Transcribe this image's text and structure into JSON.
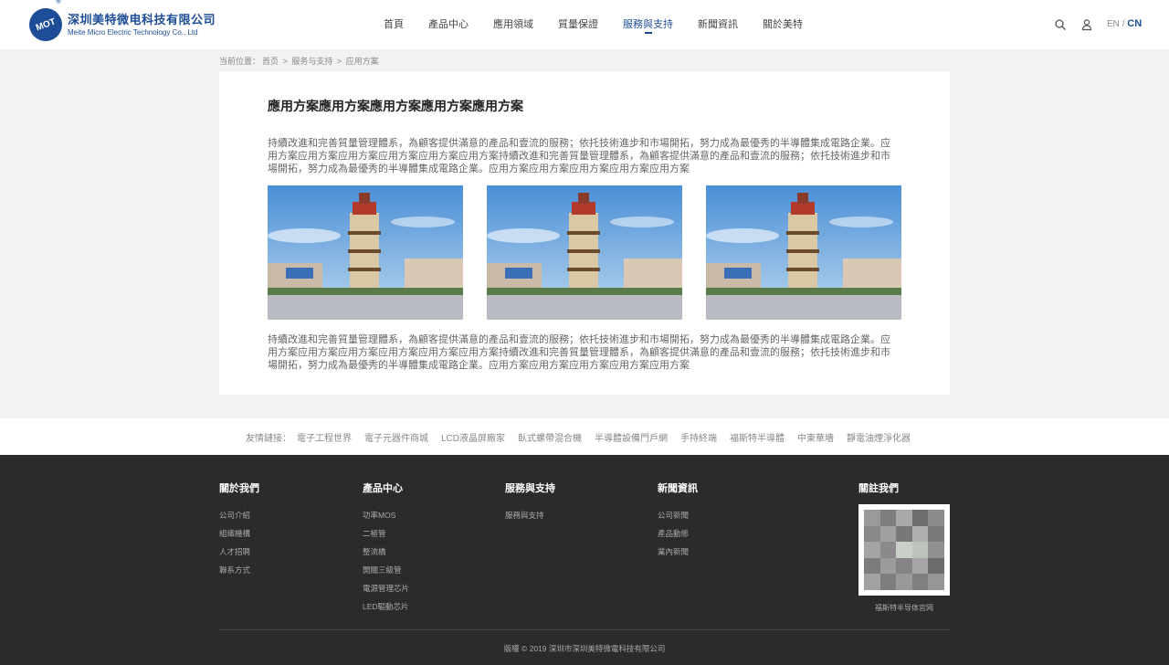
{
  "brand": {
    "mark_text": "MOT",
    "reg_symbol": "®",
    "name_cn": "深圳美特微电科技有限公司",
    "name_en": "Meite Micro Electric Technology Co., Ltd",
    "color": "#1d4d96"
  },
  "nav": {
    "items": [
      "首頁",
      "產品中心",
      "應用領域",
      "質量保證",
      "服務與支持",
      "新聞資訊",
      "關於美特"
    ],
    "active_index": 4
  },
  "header_icons": [
    "search-icon",
    "user-icon"
  ],
  "lang": {
    "en": "EN",
    "sep": "/",
    "cn": "CN"
  },
  "breadcrumb": {
    "prefix": "当前位置：",
    "items": [
      "首页",
      "服务与支持",
      "应用方案"
    ],
    "sep": ">"
  },
  "article": {
    "title": "應用方案應用方案應用方案應用方案應用方案",
    "para1": "持續改進和完善質量管理體系，為顧客提供滿意的產品和壹流的服務；依托技術進步和市場開拓，努力成為最優秀的半導體集成電路企業。应用方案应用方案应用方案应用方案应用方案应用方案持續改進和完善質量管理體系，為顧客提供滿意的產品和壹流的服務；依托技術進步和市場開拓，努力成為最優秀的半導體集成電路企業。应用方案应用方案应用方案应用方案应用方案",
    "para2": "持續改進和完善質量管理體系，為顧客提供滿意的產品和壹流的服務；依托技術進步和市場開拓，努力成為最優秀的半導體集成電路企業。应用方案应用方案应用方案应用方案应用方案应用方案持續改進和完善質量管理體系，為顧客提供滿意的產品和壹流的服務；依托技術進步和市場開拓，努力成為最優秀的半導體集成電路企業。应用方案应用方案应用方案应用方案应用方案"
  },
  "friend_links": {
    "label": "友情鏈接：",
    "items": [
      "電子工程世界",
      "電子元器件商城",
      "LCD液晶屏廠家",
      "臥式螺帶混合機",
      "半導體設備門戶網",
      "手持終端",
      "福斯特半導體",
      "中東華墻",
      "靜電油煙淨化器"
    ]
  },
  "footer": {
    "columns": [
      {
        "title": "關於我們",
        "links": [
          "公司介紹",
          "組織機構",
          "人才招聘",
          "聯系方式"
        ]
      },
      {
        "title": "產品中心",
        "links": [
          "功率MOS",
          "二極管",
          "整流橋",
          "開關三級管",
          "電源管理芯片",
          "LED驅動芯片"
        ]
      },
      {
        "title": "服務與支持",
        "links": [
          "服務與支持"
        ]
      },
      {
        "title": "新聞資訊",
        "links": [
          "公司新聞",
          "產品動態",
          "業內新聞"
        ]
      }
    ],
    "follow": {
      "title": "關註我們",
      "caption": "福斯特半导体官网"
    },
    "copyright": "版權 © 2019 深圳市深圳美特微電科技有限公司"
  }
}
